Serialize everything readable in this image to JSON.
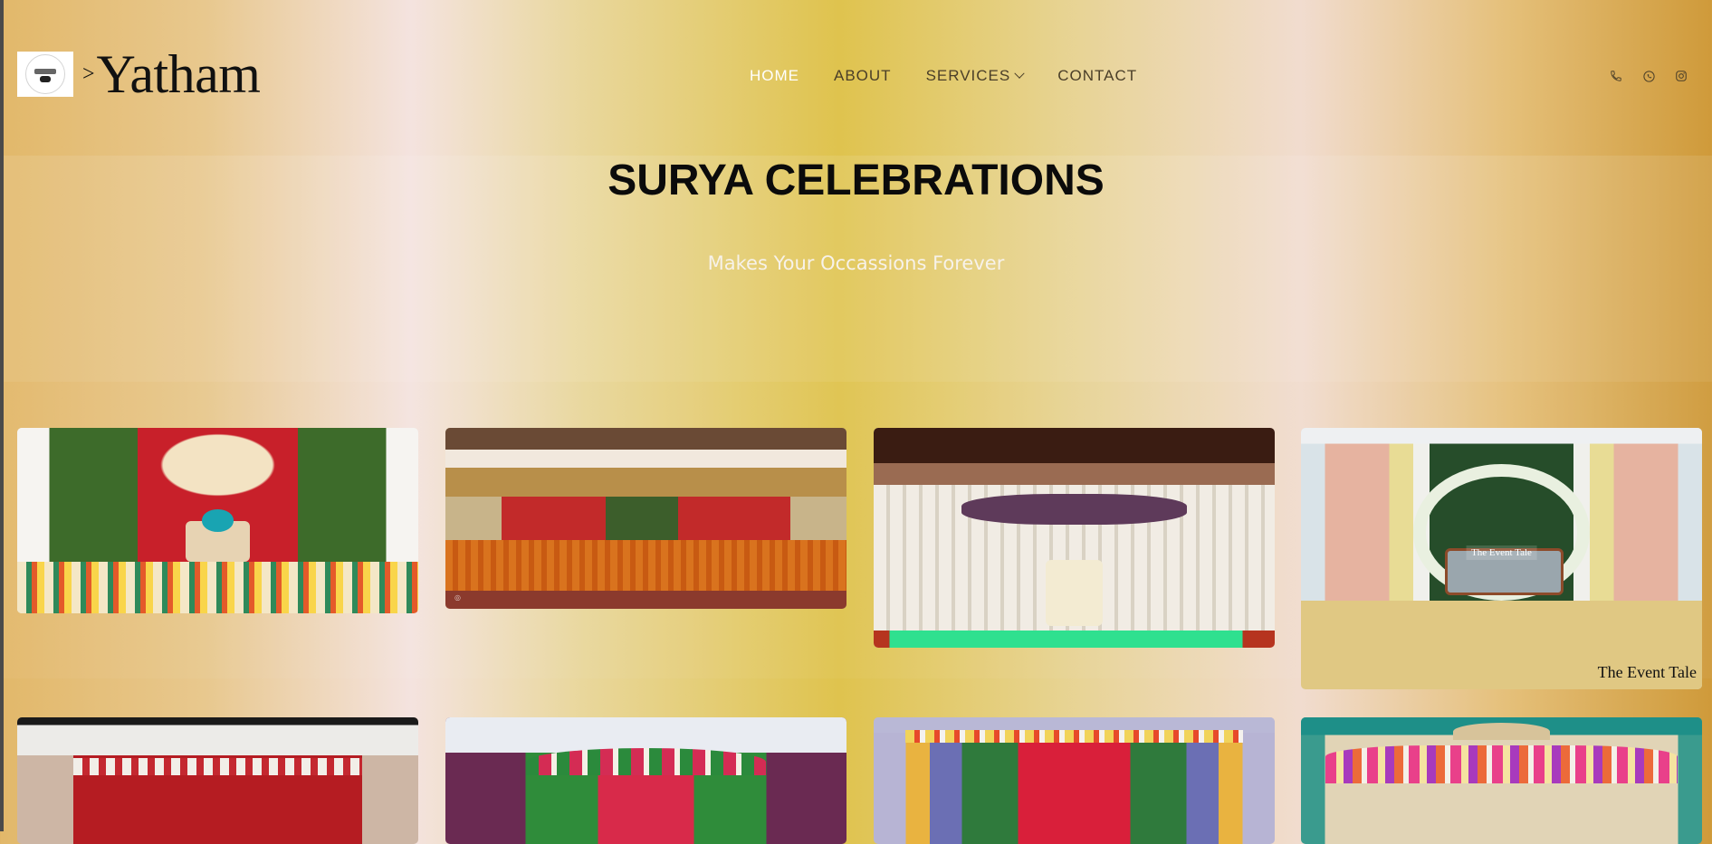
{
  "brand": {
    "caret": ">",
    "name": "Yatham"
  },
  "nav": {
    "items": [
      {
        "label": "HOME",
        "active": true
      },
      {
        "label": "ABOUT"
      },
      {
        "label": "SERVICES"
      },
      {
        "label": "CONTACT"
      }
    ]
  },
  "socials": [
    {
      "icon": "phone-icon"
    },
    {
      "icon": "whatsapp-icon"
    },
    {
      "icon": "instagram-icon"
    }
  ],
  "hero": {
    "title": "SURYA CELEBRATIONS",
    "subtitle": "Makes Your Occassions Forever"
  },
  "gallery": {
    "row1": [
      {
        "caption": ""
      },
      {
        "caption": ""
      },
      {
        "caption": ""
      },
      {
        "caption": "The Event Tale",
        "inner_caption": "The Event Tale"
      }
    ],
    "row2": [
      {},
      {},
      {},
      {}
    ]
  },
  "colors": {
    "active_nav": "#ffffff",
    "nav_text": "#4a3e28",
    "title": "#0b0b0b",
    "subtitle": "#f7f2ea",
    "gold_accent": "#dfc34e"
  }
}
